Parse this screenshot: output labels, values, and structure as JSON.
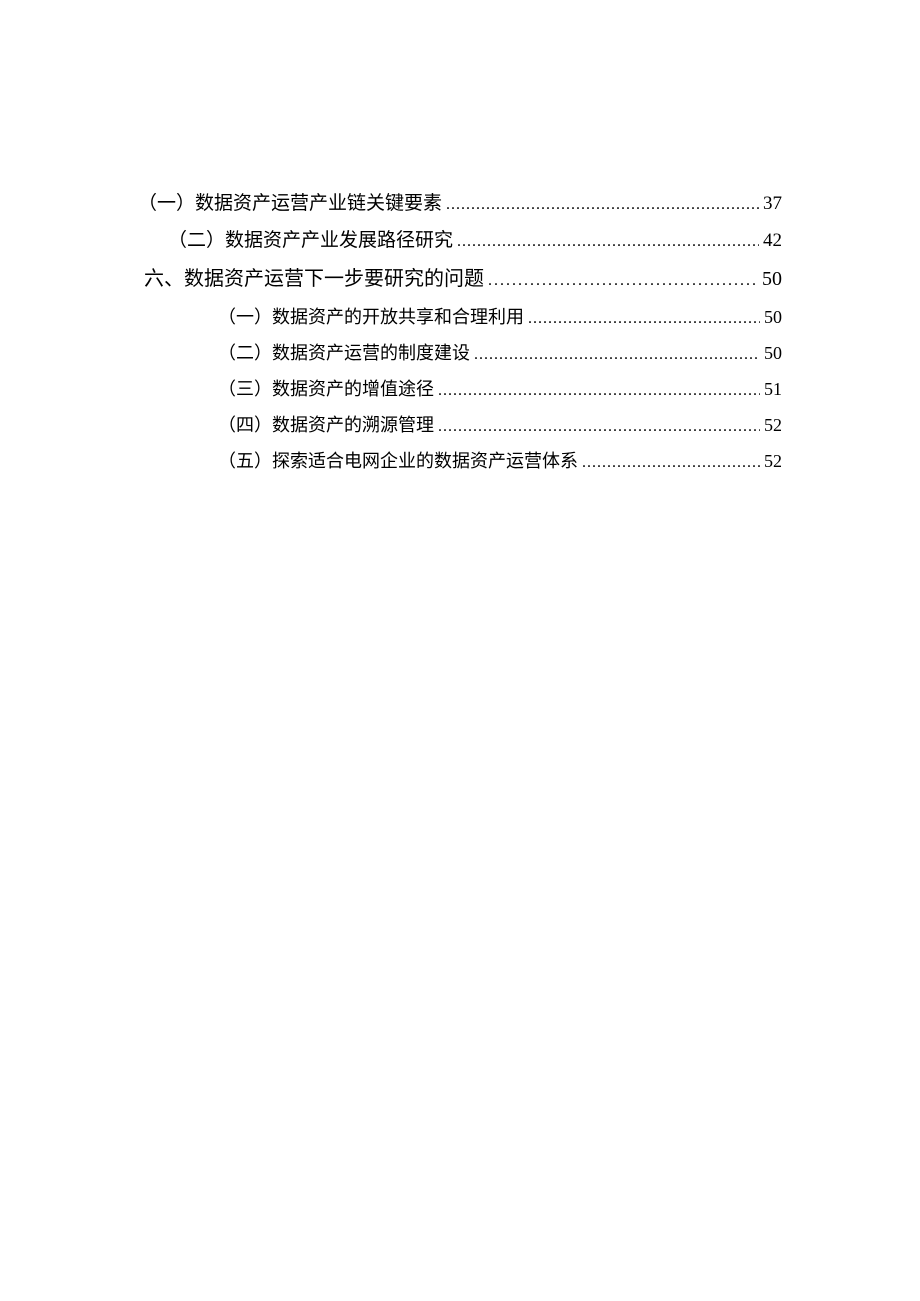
{
  "toc": {
    "entry1": {
      "label": "（一）数据资产运营产业链关键要素",
      "page": "37"
    },
    "entry2": {
      "label": "（二）数据资产产业发展路径研究",
      "page": "42"
    },
    "heading": {
      "label": "六、数据资产运营下一步要研究的问题",
      "page": "50"
    },
    "sub1": {
      "label": "（一）数据资产的开放共享和合理利用",
      "page": "50"
    },
    "sub2": {
      "label": "（二）数据资产运营的制度建设",
      "page": "50"
    },
    "sub3": {
      "label": "（三）数据资产的增值途径",
      "page": "51"
    },
    "sub4": {
      "label": "（四）数据资产的溯源管理",
      "page": "52"
    },
    "sub5": {
      "label": "（五）探索适合电网企业的数据资产运营体系",
      "page": "52"
    }
  }
}
